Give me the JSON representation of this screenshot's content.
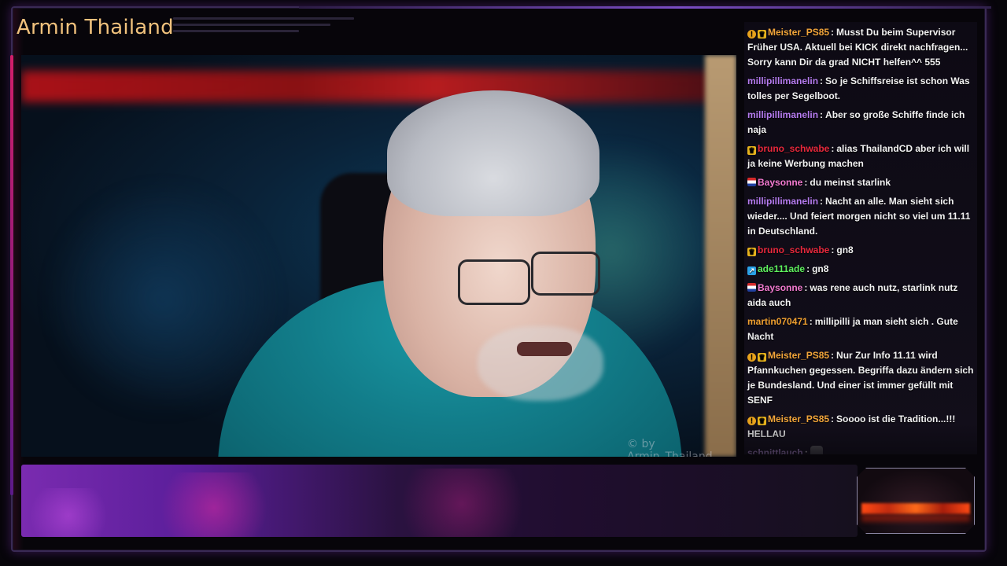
{
  "stream": {
    "title": "Armin Thailand",
    "watermark": "© by Armin_Thailand"
  },
  "colors": {
    "title": "#f1c27d",
    "frame_accent": "#d21e6a",
    "banner_purple": "#7a2bb0"
  },
  "chat": {
    "messages": [
      {
        "badges": [
          "warn-icon",
          "crown-icon"
        ],
        "user": "Meister_PS85",
        "color": "#f2a53a",
        "text": "Musst Du beim Supervisor Früher USA. Aktuell bei KICK direkt nachfragen... Sorry kann Dir da grad NICHT helfen^^ 555"
      },
      {
        "badges": [],
        "user": "millipillimanelin",
        "color": "#b67cf0",
        "text": "So je Schiffsreise ist schon Was tolles per Segelboot."
      },
      {
        "badges": [],
        "user": "millipillimanelin",
        "color": "#b67cf0",
        "text": "Aber so große Schiffe finde ich naja"
      },
      {
        "badges": [
          "crown-icon"
        ],
        "user": "bruno_schwabe",
        "color": "#e8283c",
        "text": "alias ThailandCD aber ich will ja keine Werbung machen"
      },
      {
        "badges": [
          "flag-icon"
        ],
        "user": "Baysonne",
        "color": "#f27ad0",
        "text": "du meinst starlink"
      },
      {
        "badges": [],
        "user": "millipillimanelin",
        "color": "#b67cf0",
        "text": "Nacht an alle. Man sieht sich wieder.... Und feiert morgen nicht so viel um 11.11 in Deutschland."
      },
      {
        "badges": [
          "crown-icon"
        ],
        "user": "bruno_schwabe",
        "color": "#e8283c",
        "text": "gn8"
      },
      {
        "badges": [
          "game-icon"
        ],
        "user": "ade111ade",
        "color": "#5ef05e",
        "text": "gn8"
      },
      {
        "badges": [
          "flag-icon"
        ],
        "user": "Baysonne",
        "color": "#f27ad0",
        "text": "was rene auch nutz, starlink nutz aida auch"
      },
      {
        "badges": [],
        "user": "martin070471",
        "color": "#f0a030",
        "text": "millipilli ja man sieht sich . Gute Nacht"
      },
      {
        "badges": [
          "warn-icon",
          "crown-icon"
        ],
        "user": "Meister_PS85",
        "color": "#f2a53a",
        "text": "Nur Zur Info 11.11 wird Pfannkuchen gegessen. Begriffa dazu ändern sich je Bundesland. Und einer ist immer gefüllt mit SENF"
      },
      {
        "badges": [
          "warn-icon",
          "crown-icon"
        ],
        "user": "Meister_PS85",
        "color": "#f2a53a",
        "text": "Soooo ist die Tradition...!!! HELLAU"
      },
      {
        "badges": [],
        "user": "schnittlauch",
        "color": "#c49ce8",
        "text": "",
        "emote": "emote-icon"
      }
    ]
  }
}
